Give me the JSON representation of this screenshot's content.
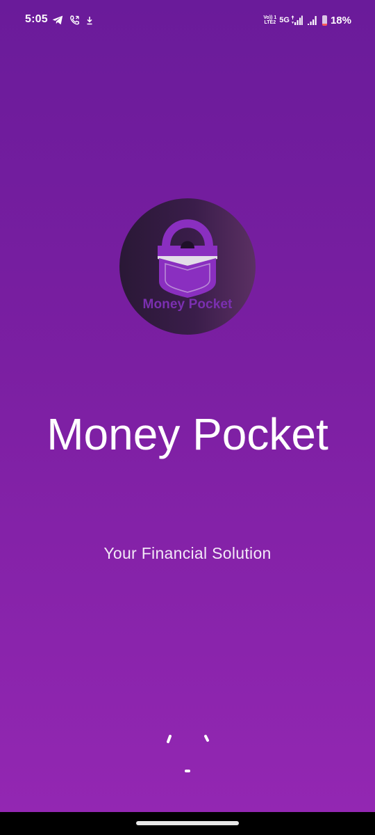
{
  "status_bar": {
    "time": "5:05",
    "volte_line1": "Vo)) 1",
    "volte_line2": "LTE2",
    "network": "5G",
    "battery_percent": "18%",
    "battery_level": 0.18,
    "left_icons": [
      "telegram-icon",
      "phone-call-icon",
      "download-icon"
    ],
    "right_icons": [
      "signal-sim1-icon",
      "signal-sim2-icon",
      "battery-icon"
    ]
  },
  "logo": {
    "text": "Money Pocket",
    "icon": "padlock-pocket-icon"
  },
  "app": {
    "title": "Money Pocket",
    "tagline": "Your Financial Solution"
  },
  "loader": {
    "icon": "loading-spinner-icon"
  },
  "colors": {
    "background_top": "#6a1b9a",
    "background_bottom": "#9327b2",
    "text": "#ffffff",
    "logo_text": "#7b2fb0"
  }
}
